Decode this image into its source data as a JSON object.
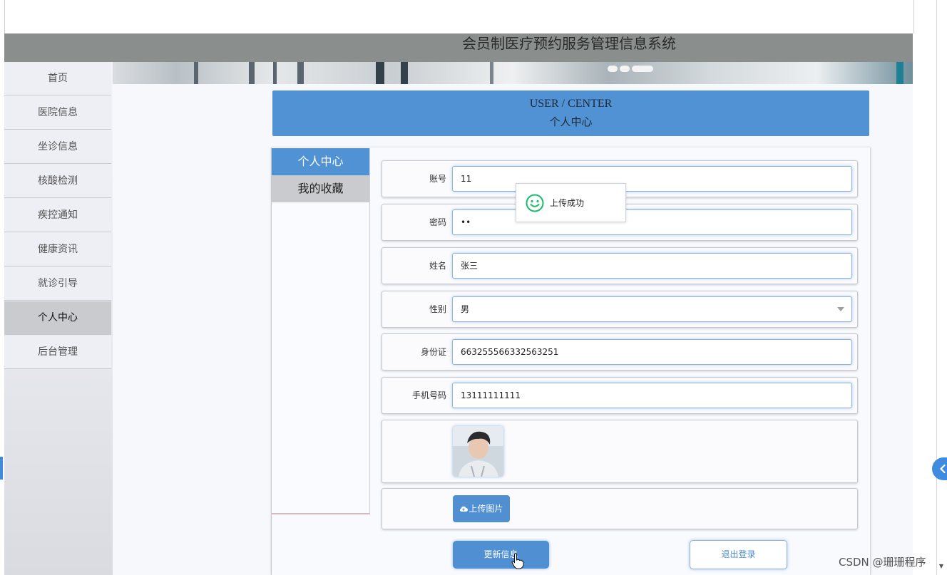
{
  "header": {
    "title": "会员制医疗预约服务管理信息系统"
  },
  "sidebar": {
    "items": [
      {
        "label": "首页"
      },
      {
        "label": "医院信息"
      },
      {
        "label": "坐诊信息"
      },
      {
        "label": "核酸检测"
      },
      {
        "label": "疾控通知"
      },
      {
        "label": "健康资讯"
      },
      {
        "label": "就诊引导"
      },
      {
        "label": "个人中心",
        "active": true
      },
      {
        "label": "后台管理"
      }
    ]
  },
  "user_center": {
    "title_en": "USER / CENTER",
    "title_cn": "个人中心"
  },
  "tabs": [
    {
      "label": "个人中心",
      "active": true
    },
    {
      "label": "我的收藏",
      "active": false
    }
  ],
  "form": {
    "account": {
      "label": "账号",
      "value": "11"
    },
    "password": {
      "label": "密码",
      "value": "••"
    },
    "name": {
      "label": "姓名",
      "value": "张三"
    },
    "gender": {
      "label": "性别",
      "value": "男"
    },
    "id_card": {
      "label": "身份证",
      "value": "663255566332563251"
    },
    "phone": {
      "label": "手机号码",
      "value": "13111111111"
    },
    "upload_label": "上传图片",
    "update_label": "更新信息",
    "logout_label": "退出登录"
  },
  "toast": {
    "message": "上传成功"
  },
  "watermark": "CSDN @珊珊程序",
  "colors": {
    "accent": "#5092d4",
    "header_bg": "#8a8f8d",
    "success": "#19be6b"
  }
}
